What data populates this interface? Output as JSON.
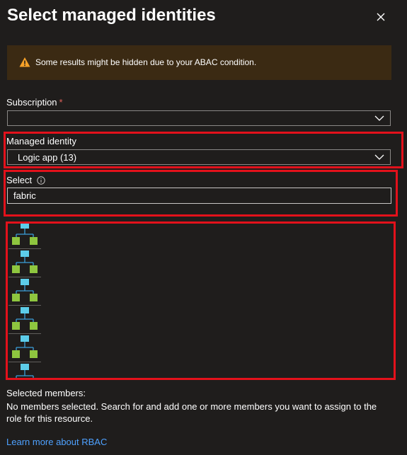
{
  "panel": {
    "title": "Select managed identities",
    "close_icon": "close-icon"
  },
  "warning": {
    "icon": "warning-icon",
    "text": "Some results might be hidden due to your ABAC condition.",
    "color": "#3b2a13"
  },
  "subscription": {
    "label": "Subscription",
    "required_marker": "*",
    "value": ""
  },
  "managed_identity": {
    "label": "Managed identity",
    "value": "Logic app (13)"
  },
  "select": {
    "label": "Select",
    "info_icon": "info-icon",
    "value": "fabric"
  },
  "results": {
    "item_icon": "logic-app-icon",
    "visible_items": 6
  },
  "selected_members": {
    "title": "Selected members:",
    "text": "No members selected. Search for and add one or more members you want to assign to the role for this resource."
  },
  "link": {
    "label": "Learn more about RBAC"
  },
  "colors": {
    "background": "#1f1d1c",
    "highlight": "#e3111b",
    "link": "#4ea1ff"
  }
}
